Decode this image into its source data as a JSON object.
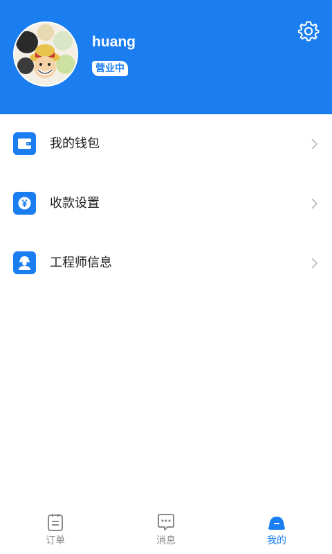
{
  "header": {
    "username": "huang",
    "status": "营业中",
    "avatar_icon": "avatar-illustration",
    "settings_icon": "gear-icon",
    "background_color": "#1a7ef0"
  },
  "menu": {
    "items": [
      {
        "label": "我的钱包",
        "icon": "wallet-icon"
      },
      {
        "label": "收款设置",
        "icon": "yen-coin-icon"
      },
      {
        "label": "工程师信息",
        "icon": "engineer-icon"
      }
    ],
    "chevron_icon": "chevron-right-icon"
  },
  "tabbar": {
    "tabs": [
      {
        "label": "订单",
        "icon": "clipboard-icon",
        "active": false
      },
      {
        "label": "消息",
        "icon": "chat-bubble-icon",
        "active": false
      },
      {
        "label": "我的",
        "icon": "helmet-icon",
        "active": true
      }
    ],
    "active_color": "#1a7ef0",
    "inactive_color": "#8a8a8a"
  }
}
